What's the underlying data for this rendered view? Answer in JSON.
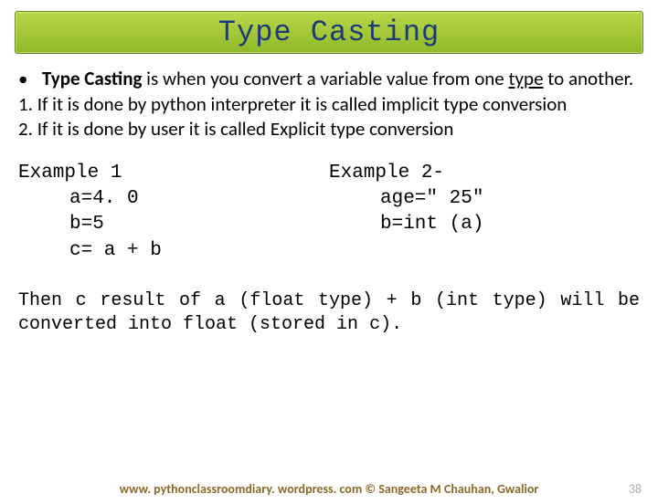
{
  "title": "Type Casting",
  "bullet": "•",
  "intro_strong": "Type Casting",
  "intro_rest_1": " is when you convert a variable value from one ",
  "intro_underline": "type",
  "intro_rest_2": " to another.",
  "line1": "1. If it is done by python interpreter it is called implicit type conversion",
  "line2": "2. If it is done by user it is called Explicit type conversion",
  "ex1_title": "Example 1",
  "ex1_a": "a=4. 0",
  "ex1_b": "b=5",
  "ex1_c": "c= a + b",
  "ex2_title": "Example 2-",
  "ex2_a": "age=\" 25\"",
  "ex2_b": "b=int (a)",
  "conclusion": "Then c result of a (float type) + b (int type) will be converted into float (stored in  c).",
  "footer": "www. pythonclassroomdiary. wordpress. com ©  Sangeeta M Chauhan, Gwalior",
  "page_number": "38"
}
